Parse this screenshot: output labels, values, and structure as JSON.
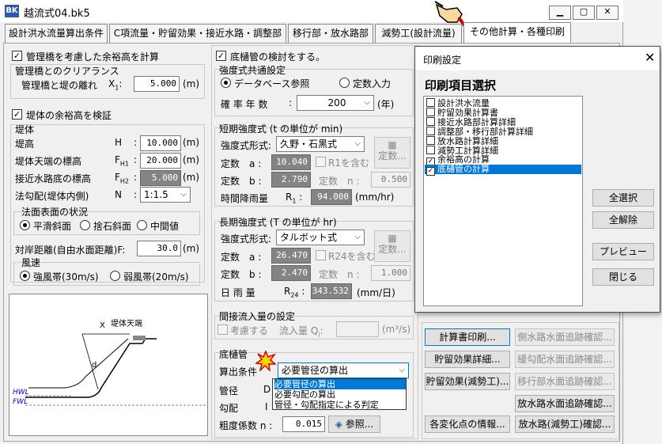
{
  "window": {
    "title": "越流式04.bk5",
    "icon": "app-icon"
  },
  "tabs": [
    "設計洪水流量算出条件",
    "C項流量・貯留効果・接近水路・調整部",
    "移行部・放水路部",
    "減勢工(設計流量)",
    "その他計算・各種印刷"
  ],
  "left": {
    "clearance_check": "管理橋を考慮した余裕高を計算",
    "clearance_group": "管理橋とのクリアランス",
    "bridge_dist_label": "管理橋と堤の離れ",
    "bridge_dist_sym": "X",
    "bridge_dist_sub": "1",
    "bridge_dist_value": "5.000",
    "unit_m": "(m)",
    "embank_check": "堤体の余裕高を検証",
    "embank_group": "堤体",
    "crest_label": "堤高",
    "crest_sym": "H",
    "crest_value": "10.000",
    "crest_toe_label": "堤体天端の標高",
    "crest_toe_sym": "F",
    "crest_toe_sub": "H1",
    "crest_toe_value": "20.000",
    "channel_label": "接近水路底の標高",
    "channel_sym": "F",
    "channel_sub": "H2",
    "channel_value": "5.000",
    "slope_label": "法勾配(堤体内側)",
    "slope_sym": "N",
    "slope_value": "1:1.5",
    "surface_group": "法面表面の状況",
    "surface_opts": [
      "平滑斜面",
      "捨石斜面",
      "中間値"
    ],
    "freeboard_label": "対岸距離(自由水面距離)F:",
    "freeboard_value": "30.0",
    "wind_group": "風速",
    "wind_opts": [
      "強風帯(30m/s)",
      "弱風帯(20m/s)"
    ],
    "colon": ":",
    "diagram": {
      "crest_label": "堤体天端",
      "x_label": "X",
      "d_label": "d",
      "hwl": "HWL",
      "fwl": "FWL"
    }
  },
  "middle": {
    "bottom_check": "底樋管の検討をする。",
    "common_group": "強度式共通設定",
    "db_radio": "データベース参照",
    "fixed_radio": "定数入力",
    "prob_label": "確 率 年 数",
    "prob_value": "200",
    "prob_unit": "(年)",
    "short_group": "短期強度式 (t の単位が min)",
    "short_formula_label": "強度式形式:",
    "short_formula_value": "久野・石黒式",
    "const_label": "定数",
    "a_label": "a",
    "b_label": "b",
    "n_label": "n",
    "short_a": "10.040",
    "short_b": "2.790",
    "short_n": "0.500",
    "r1_check": "R1を含む",
    "const_btn": "定数...",
    "hourly_label": "時間降雨量",
    "r1_sym": "R",
    "r1_sub": "1",
    "r1_value": "94.000",
    "r1_unit": "(mm/hr)",
    "long_group": "長期強度式 (T の単位が hr)",
    "long_formula_value": "タルボット式",
    "long_a": "26.470",
    "long_b": "2.470",
    "long_n": "1.000",
    "r24_check": "R24を含む",
    "daily_label": "日 雨 量",
    "r24_sym": "R",
    "r24_sub": "24",
    "r24_value": "343.532",
    "r24_unit": "(mm/日)",
    "inflow_group": "間接流入量の設定",
    "inflow_check": "考慮する",
    "inflow_label": "流入量 Q",
    "inflow_sub": "i",
    "inflow_unit": "(m³/s)",
    "pipe_group": "底樋管",
    "calc_label": "算出条件",
    "calc_value": "必要管径の算出",
    "diam_label": "管径",
    "diam_sym": "D",
    "grad_label": "勾配",
    "grad_sym": "I",
    "rough_label": "粗度係数 n",
    "rough_value": "0.015",
    "ref_btn": "参照...",
    "dropdown_opts": [
      "必要管径の算出",
      "必要勾配の算出",
      "管径・勾配指定による判定"
    ]
  },
  "buttons": [
    [
      "計算書印刷...",
      "側水路水面追跡確認..."
    ],
    [
      "貯留効果詳細...",
      "緩勾配水面追跡確認..."
    ],
    [
      "貯留効果(減勢工)...",
      "移行部水面追跡確認..."
    ],
    [
      "",
      "放水路水面追跡確認..."
    ],
    [
      "各変化点の情報...",
      "放水路(減勢工)確認..."
    ]
  ],
  "print_dialog": {
    "title": "印刷設定",
    "heading": "印刷項目選択",
    "items": [
      {
        "label": "設計洪水流量",
        "checked": false
      },
      {
        "label": "貯留効果計算書",
        "checked": false
      },
      {
        "label": "接近水路部計算詳細",
        "checked": false
      },
      {
        "label": "調整部・移行部計算詳細",
        "checked": false
      },
      {
        "label": "放水路計算詳細",
        "checked": false
      },
      {
        "label": "減勢工計算詳細",
        "checked": false
      },
      {
        "label": "余裕高の計算",
        "checked": true
      },
      {
        "label": "底樋管の計算",
        "checked": true
      }
    ],
    "select_all": "全選択",
    "clear_all": "全解除",
    "preview": "プレビュー",
    "close": "閉じる"
  }
}
